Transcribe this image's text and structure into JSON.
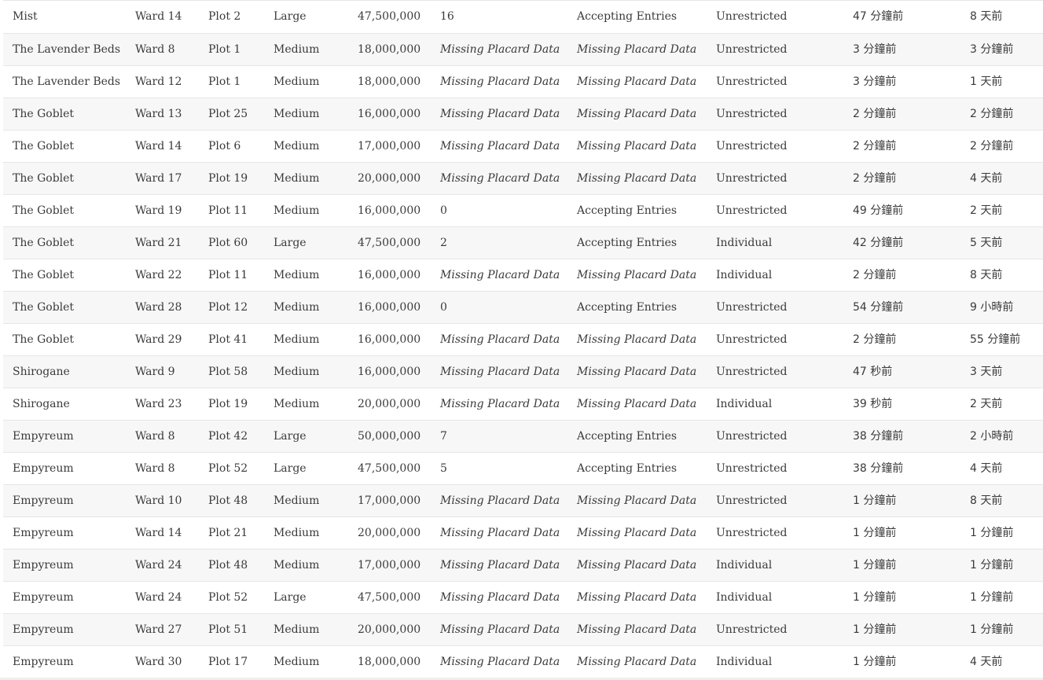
{
  "rows": [
    [
      "Mist",
      "Ward 14",
      "Plot 2",
      "Large",
      "47,500,000",
      "16",
      "Accepting Entries",
      "Unrestricted",
      "47 分鐘前",
      "8 天前"
    ],
    [
      "The Lavender Beds",
      "Ward 8",
      "Plot 1",
      "Medium",
      "18,000,000",
      "Missing Placard Data",
      "Missing Placard Data",
      "Unrestricted",
      "3 分鐘前",
      "3 分鐘前"
    ],
    [
      "The Lavender Beds",
      "Ward 12",
      "Plot 1",
      "Medium",
      "18,000,000",
      "Missing Placard Data",
      "Missing Placard Data",
      "Unrestricted",
      "3 分鐘前",
      "1 天前"
    ],
    [
      "The Goblet",
      "Ward 13",
      "Plot 25",
      "Medium",
      "16,000,000",
      "Missing Placard Data",
      "Missing Placard Data",
      "Unrestricted",
      "2 分鐘前",
      "2 分鐘前"
    ],
    [
      "The Goblet",
      "Ward 14",
      "Plot 6",
      "Medium",
      "17,000,000",
      "Missing Placard Data",
      "Missing Placard Data",
      "Unrestricted",
      "2 分鐘前",
      "2 分鐘前"
    ],
    [
      "The Goblet",
      "Ward 17",
      "Plot 19",
      "Medium",
      "20,000,000",
      "Missing Placard Data",
      "Missing Placard Data",
      "Unrestricted",
      "2 分鐘前",
      "4 天前"
    ],
    [
      "The Goblet",
      "Ward 19",
      "Plot 11",
      "Medium",
      "16,000,000",
      "0",
      "Accepting Entries",
      "Unrestricted",
      "49 分鐘前",
      "2 天前"
    ],
    [
      "The Goblet",
      "Ward 21",
      "Plot 60",
      "Large",
      "47,500,000",
      "2",
      "Accepting Entries",
      "Individual",
      "42 分鐘前",
      "5 天前"
    ],
    [
      "The Goblet",
      "Ward 22",
      "Plot 11",
      "Medium",
      "16,000,000",
      "Missing Placard Data",
      "Missing Placard Data",
      "Individual",
      "2 分鐘前",
      "8 天前"
    ],
    [
      "The Goblet",
      "Ward 28",
      "Plot 12",
      "Medium",
      "16,000,000",
      "0",
      "Accepting Entries",
      "Unrestricted",
      "54 分鐘前",
      "9 小時前"
    ],
    [
      "The Goblet",
      "Ward 29",
      "Plot 41",
      "Medium",
      "16,000,000",
      "Missing Placard Data",
      "Missing Placard Data",
      "Unrestricted",
      "2 分鐘前",
      "55 分鐘前"
    ],
    [
      "Shirogane",
      "Ward 9",
      "Plot 58",
      "Medium",
      "16,000,000",
      "Missing Placard Data",
      "Missing Placard Data",
      "Unrestricted",
      "47 秒前",
      "3 天前"
    ],
    [
      "Shirogane",
      "Ward 23",
      "Plot 19",
      "Medium",
      "20,000,000",
      "Missing Placard Data",
      "Missing Placard Data",
      "Individual",
      "39 秒前",
      "2 天前"
    ],
    [
      "Empyreum",
      "Ward 8",
      "Plot 42",
      "Large",
      "50,000,000",
      "7",
      "Accepting Entries",
      "Unrestricted",
      "38 分鐘前",
      "2 小時前"
    ],
    [
      "Empyreum",
      "Ward 8",
      "Plot 52",
      "Large",
      "47,500,000",
      "5",
      "Accepting Entries",
      "Unrestricted",
      "38 分鐘前",
      "4 天前"
    ],
    [
      "Empyreum",
      "Ward 10",
      "Plot 48",
      "Medium",
      "17,000,000",
      "Missing Placard Data",
      "Missing Placard Data",
      "Unrestricted",
      "1 分鐘前",
      "8 天前"
    ],
    [
      "Empyreum",
      "Ward 14",
      "Plot 21",
      "Medium",
      "20,000,000",
      "Missing Placard Data",
      "Missing Placard Data",
      "Unrestricted",
      "1 分鐘前",
      "1 分鐘前"
    ],
    [
      "Empyreum",
      "Ward 24",
      "Plot 48",
      "Medium",
      "17,000,000",
      "Missing Placard Data",
      "Missing Placard Data",
      "Individual",
      "1 分鐘前",
      "1 分鐘前"
    ],
    [
      "Empyreum",
      "Ward 24",
      "Plot 52",
      "Large",
      "47,500,000",
      "Missing Placard Data",
      "Missing Placard Data",
      "Individual",
      "1 分鐘前",
      "1 分鐘前"
    ],
    [
      "Empyreum",
      "Ward 27",
      "Plot 51",
      "Medium",
      "20,000,000",
      "Missing Placard Data",
      "Missing Placard Data",
      "Unrestricted",
      "1 分鐘前",
      "1 分鐘前"
    ],
    [
      "Empyreum",
      "Ward 30",
      "Plot 17",
      "Medium",
      "18,000,000",
      "Missing Placard Data",
      "Missing Placard Data",
      "Individual",
      "1 分鐘前",
      "4 天前"
    ]
  ],
  "column_keys": [
    "district",
    "ward",
    "plot",
    "size",
    "price",
    "entrants",
    "lottery_phase",
    "purchase_restriction",
    "last_seen",
    "first_seen"
  ]
}
